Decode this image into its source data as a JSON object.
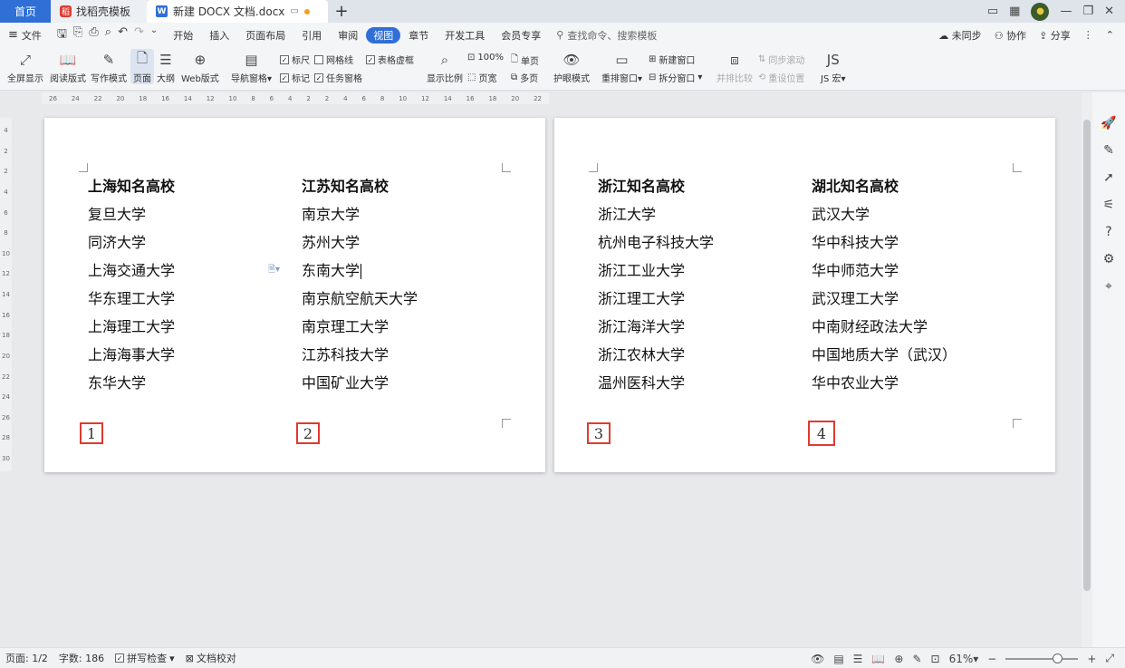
{
  "tabs": {
    "home": "首页",
    "template": "找稻壳模板",
    "doc": "新建 DOCX 文档.docx",
    "new": "+"
  },
  "menu": {
    "file": "文件",
    "items": [
      "开始",
      "插入",
      "页面布局",
      "引用",
      "审阅",
      "视图",
      "章节",
      "开发工具",
      "会员专享"
    ],
    "search": "查找命令、搜索模板",
    "sync": "未同步",
    "collab": "协作",
    "share": "分享"
  },
  "ribbon": {
    "fullscreen": "全屏显示",
    "reading": "阅读版式",
    "writing": "写作模式",
    "page": "页面",
    "outline": "大纲",
    "web": "Web版式",
    "navpane": "导航窗格",
    "ruler": "标尺",
    "gridlines": "网格线",
    "tablegrid": "表格虚框",
    "marks": "标记",
    "taskpane": "任务窗格",
    "zoom_ratio": "显示比例",
    "ratio_100": "100%",
    "single_page": "单页",
    "page_width": "页宽",
    "multi_page": "多页",
    "eye_mode": "护眼模式",
    "rearrange": "重排窗口",
    "new_window": "新建窗口",
    "split_window": "拆分窗口",
    "side_by_side": "并排比较",
    "sync_scroll": "同步滚动",
    "reset_pos": "重设位置",
    "js_macro": "JS 宏"
  },
  "ruler_labels": [
    "26",
    "24",
    "22",
    "20",
    "18",
    "16",
    "14",
    "12",
    "10",
    "8",
    "6",
    "4",
    "2",
    "2",
    "4",
    "6",
    "8",
    "10",
    "12",
    "14",
    "16",
    "18",
    "20",
    "22"
  ],
  "vruler_labels": [
    "4",
    "2",
    "2",
    "4",
    "6",
    "8",
    "10",
    "12",
    "14",
    "16",
    "18",
    "20",
    "22",
    "24",
    "26",
    "28",
    "30"
  ],
  "columns": [
    {
      "header": "上海知名高校",
      "items": [
        "复旦大学",
        "同济大学",
        "上海交通大学",
        "华东理工大学",
        "上海理工大学",
        "上海海事大学",
        "东华大学"
      ],
      "page_num": "1"
    },
    {
      "header": "江苏知名高校",
      "items": [
        "南京大学",
        "苏州大学",
        "东南大学",
        "南京航空航天大学",
        "南京理工大学",
        "江苏科技大学",
        "中国矿业大学"
      ],
      "page_num": "2"
    },
    {
      "header": "浙江知名高校",
      "items": [
        "浙江大学",
        "杭州电子科技大学",
        "浙江工业大学",
        "浙江理工大学",
        "浙江海洋大学",
        "浙江农林大学",
        "温州医科大学"
      ],
      "page_num": "3"
    },
    {
      "header": "湖北知名高校",
      "items": [
        "武汉大学",
        "华中科技大学",
        "华中师范大学",
        "武汉理工大学",
        "中南财经政法大学",
        "中国地质大学（武汉）",
        "华中农业大学"
      ],
      "page_num": "4"
    }
  ],
  "status": {
    "page": "页面: 1/2",
    "words": "字数: 186",
    "spell": "拼写检查",
    "proof": "文档校对",
    "zoom": "61%"
  }
}
